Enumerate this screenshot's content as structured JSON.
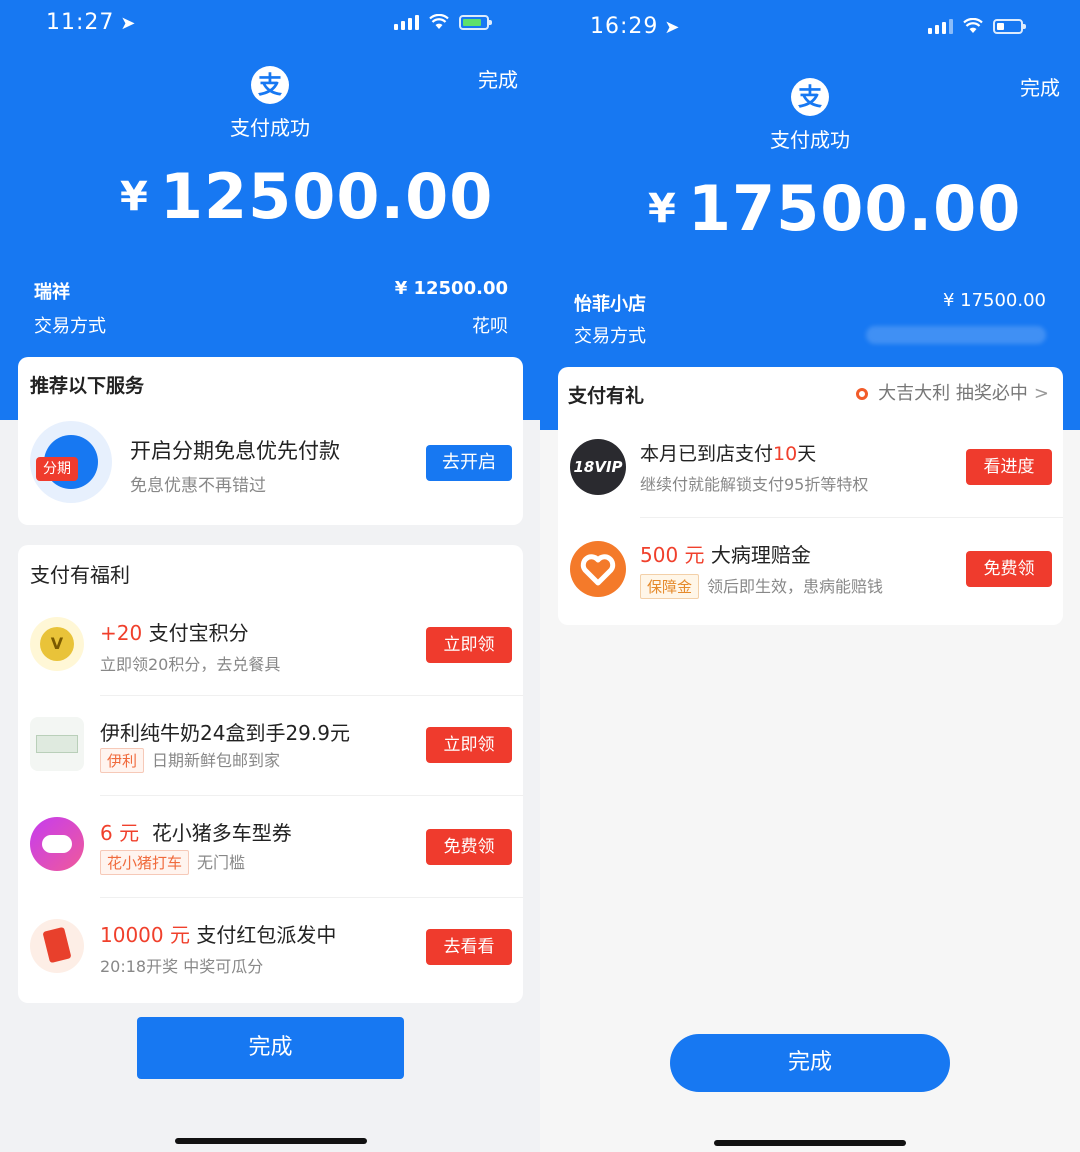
{
  "left": {
    "status": {
      "time": "11:27"
    },
    "done_top": "完成",
    "logo_char": "支",
    "pay_success": "支付成功",
    "currency": "¥",
    "amount": "12500.00",
    "merchant": "瑞祥",
    "merchant_amount": "¥ 12500.00",
    "method_label": "交易方式",
    "method_value": "花呗",
    "recommend": {
      "title": "推荐以下服务",
      "icon_label": "分期",
      "item_title": "开启分期免息优先付款",
      "item_sub": "免息优惠不再错过",
      "button": "去开启"
    },
    "benefits": {
      "title": "支付有福利",
      "items": [
        {
          "amount": "+20",
          "title": "支付宝积分",
          "sub": "立即领20积分，去兑餐具",
          "tag": "",
          "button": "立即领"
        },
        {
          "amount": "",
          "title": "伊利纯牛奶24盒到手29.9元",
          "sub": "日期新鲜包邮到家",
          "tag": "伊利",
          "button": "立即领"
        },
        {
          "amount": "6 元",
          "title": "花小猪多车型券",
          "sub": "无门槛",
          "tag": "花小猪打车",
          "button": "免费领"
        },
        {
          "amount": "10000 元",
          "title": "支付红包派发中",
          "sub": "20:18开奖 中奖可瓜分",
          "tag": "",
          "button": "去看看"
        }
      ]
    },
    "bottom_done": "完成",
    "colors": {
      "brand": "#1778f2",
      "red": "#ef3b2d"
    }
  },
  "right": {
    "status": {
      "time": "16:29"
    },
    "done_top": "完成",
    "logo_char": "支",
    "pay_success": "支付成功",
    "currency": "¥",
    "amount": "17500.00",
    "merchant": "怡菲小店",
    "merchant_amount": "¥ 17500.00",
    "method_label": "交易方式",
    "gift": {
      "title": "支付有礼",
      "promo": "大吉大利 抽奖必中",
      "items": [
        {
          "icon_label": "18VIP",
          "title_pre": "本月已到店支付",
          "title_num": "10",
          "title_post": "天",
          "sub": "继续付就能解锁支付95折等特权",
          "button": "看进度"
        },
        {
          "amount": "500 元",
          "title": "大病理赔金",
          "tag": "保障金",
          "sub": "领后即生效，患病能赔钱",
          "button": "免费领"
        }
      ]
    },
    "bottom_done": "完成"
  }
}
